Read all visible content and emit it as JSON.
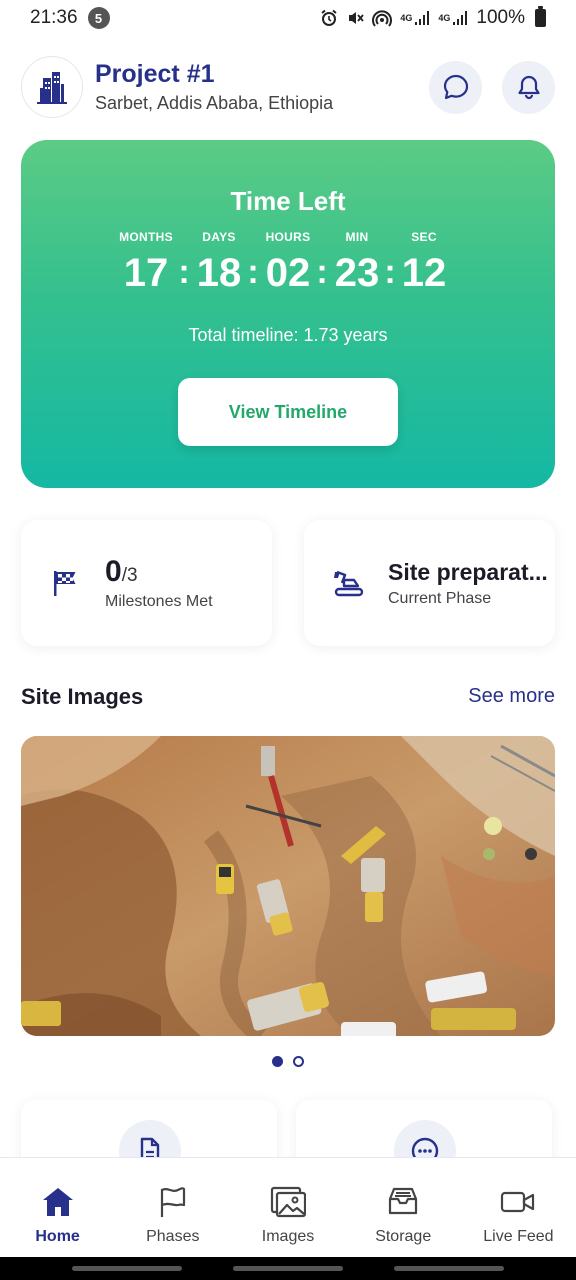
{
  "status_bar": {
    "time": "21:36",
    "notification_count": "5",
    "network_1": "4G",
    "network_2": "4G",
    "battery": "100%"
  },
  "header": {
    "title": "Project #1",
    "location": "Sarbet, Addis Ababa, Ethiopia"
  },
  "countdown": {
    "title": "Time Left",
    "units": [
      "MONTHS",
      "DAYS",
      "HOURS",
      "MIN",
      "SEC"
    ],
    "values": [
      "17",
      "18",
      "02",
      "23",
      "12"
    ],
    "separator": ":",
    "total_timeline": "Total timeline: 1.73 years",
    "button_label": "View Timeline"
  },
  "stats": {
    "milestones": {
      "value": "0",
      "total": "/3",
      "label": "Milestones Met"
    },
    "phase": {
      "value": "Site preparat...",
      "label": "Current Phase"
    }
  },
  "site_images": {
    "title": "Site Images",
    "see_more": "See more",
    "page_count": 2,
    "active_page": 1
  },
  "nav": {
    "items": [
      {
        "label": "Home",
        "icon": "home-icon",
        "active": true
      },
      {
        "label": "Phases",
        "icon": "flag-icon",
        "active": false
      },
      {
        "label": "Images",
        "icon": "images-icon",
        "active": false
      },
      {
        "label": "Storage",
        "icon": "storage-icon",
        "active": false
      },
      {
        "label": "Live Feed",
        "icon": "video-icon",
        "active": false
      }
    ]
  },
  "colors": {
    "primary": "#27318b",
    "card_gradient_top": "#5ccb85",
    "card_gradient_bottom": "#15b8a4",
    "button_text": "#21a96a"
  }
}
